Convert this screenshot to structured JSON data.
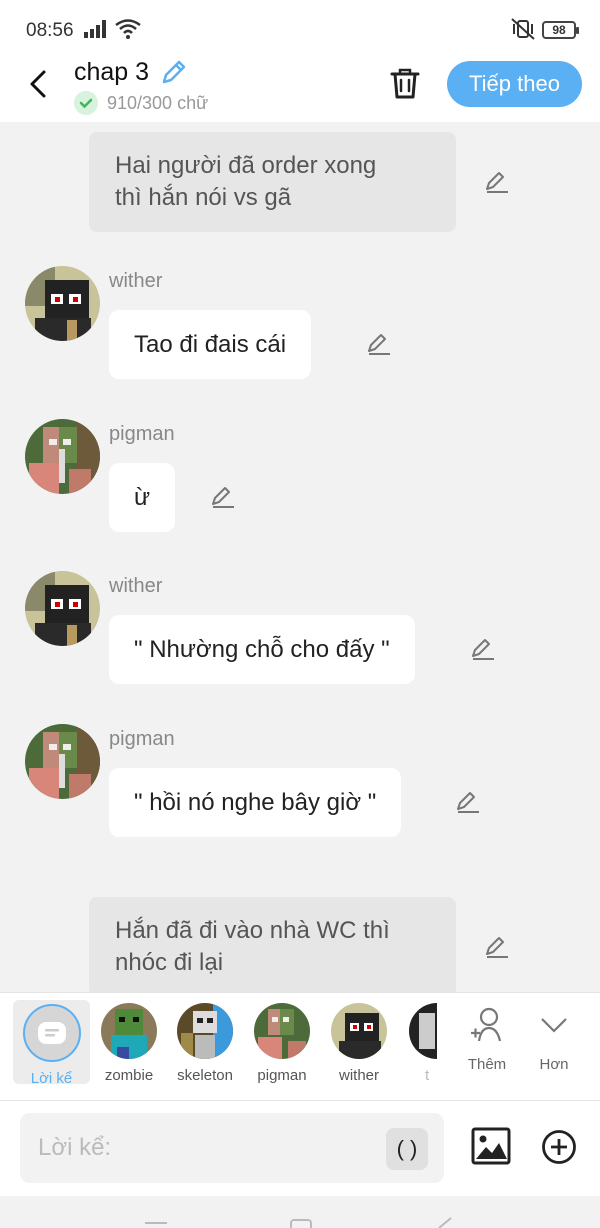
{
  "status": {
    "time": "08:56",
    "battery": "98"
  },
  "header": {
    "title": "chap 3",
    "word_count": "910/300 chữ",
    "next_label": "Tiếp theo"
  },
  "messages": {
    "narr1": {
      "line1": "Hai người đã order xong",
      "line2": "thì hắn nói vs gã"
    },
    "m1": {
      "name": "wither",
      "text": "Tao đi đais cái"
    },
    "m2": {
      "name": "pigman",
      "text": "ừ"
    },
    "m3": {
      "name": "wither",
      "text": "\" Nhường chỗ cho đấy \""
    },
    "m4": {
      "name": "pigman",
      "text": "\" hồi nó nghe bây giờ \""
    },
    "narr2": {
      "line1": "Hắn đã đi vào nhà WC thì",
      "line2": "nhóc đi lại"
    }
  },
  "characters": {
    "narrator": "Lời kể",
    "c1": "zombie",
    "c2": "skeleton",
    "c3": "pigman",
    "c4": "wither",
    "c5": "t"
  },
  "actions": {
    "add_label": "Thêm",
    "more_label": "Hơn"
  },
  "composer": {
    "placeholder": "Lời kể:",
    "paren": "( )"
  },
  "colors": {
    "accent": "#5ab0f2",
    "background": "#f2f2f2",
    "narration_bg": "#e6e6e6"
  }
}
